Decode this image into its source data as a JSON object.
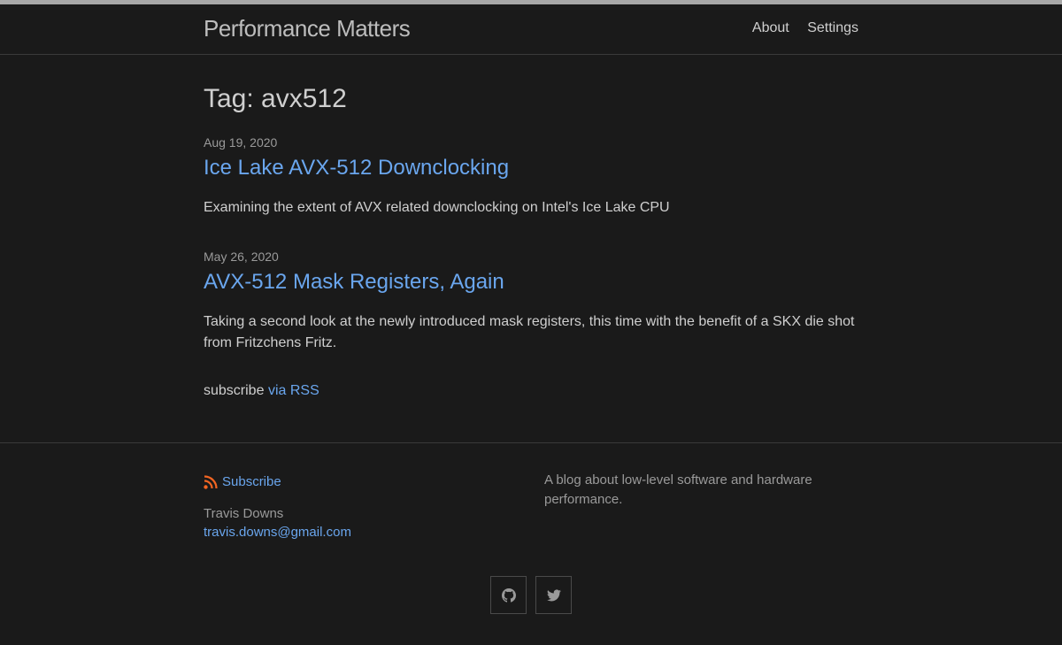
{
  "header": {
    "site_title": "Performance Matters",
    "nav": [
      "About",
      "Settings"
    ]
  },
  "main": {
    "heading": "Tag: avx512",
    "posts": [
      {
        "date": "Aug 19, 2020",
        "title": "Ice Lake AVX-512 Downclocking",
        "excerpt": "Examining the extent of AVX related downclocking on Intel's Ice Lake CPU"
      },
      {
        "date": "May 26, 2020",
        "title": "AVX-512 Mask Registers, Again",
        "excerpt": "Taking a second look at the newly introduced mask registers, this time with the benefit of a SKX die shot from Fritzchens Fritz."
      }
    ],
    "subscribe_prefix": "subscribe",
    "subscribe_link": "via RSS"
  },
  "footer": {
    "subscribe_label": "Subscribe",
    "author_name": "Travis Downs",
    "author_email": "travis.downs@gmail.com",
    "description": "A blog about low-level software and hardware performance.",
    "social_icons": [
      "github-icon",
      "twitter-icon"
    ]
  },
  "colors": {
    "background": "#1a1a1a",
    "link": "#6aa6ee",
    "rss": "#f26522",
    "top_stripe": "#a8a8a8"
  }
}
